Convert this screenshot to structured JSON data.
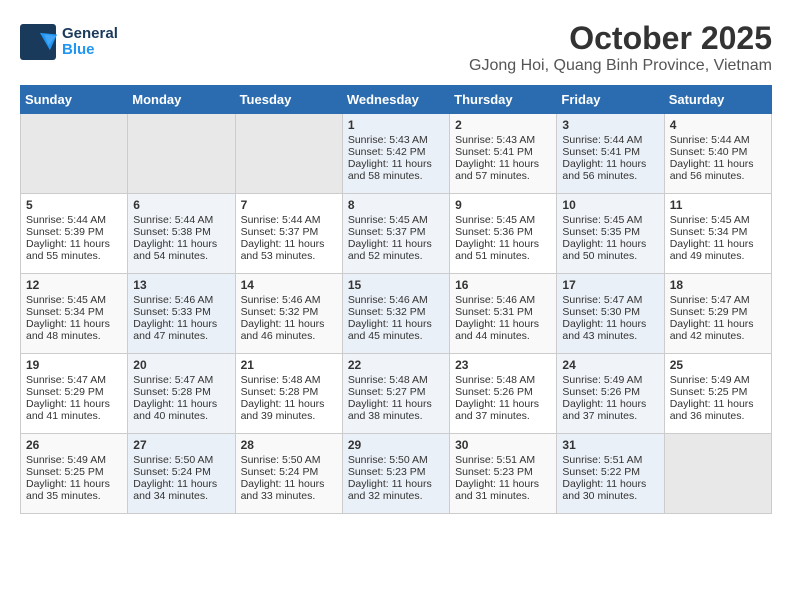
{
  "app": {
    "logo_general": "General",
    "logo_blue": "Blue",
    "title": "October 2025",
    "subtitle": "GJong Hoi, Quang Binh Province, Vietnam"
  },
  "calendar": {
    "days_of_week": [
      "Sunday",
      "Monday",
      "Tuesday",
      "Wednesday",
      "Thursday",
      "Friday",
      "Saturday"
    ],
    "weeks": [
      [
        {
          "day": "",
          "info": ""
        },
        {
          "day": "",
          "info": ""
        },
        {
          "day": "",
          "info": ""
        },
        {
          "day": "1",
          "info": "Sunrise: 5:43 AM\nSunset: 5:42 PM\nDaylight: 11 hours\nand 58 minutes."
        },
        {
          "day": "2",
          "info": "Sunrise: 5:43 AM\nSunset: 5:41 PM\nDaylight: 11 hours\nand 57 minutes."
        },
        {
          "day": "3",
          "info": "Sunrise: 5:44 AM\nSunset: 5:41 PM\nDaylight: 11 hours\nand 56 minutes."
        },
        {
          "day": "4",
          "info": "Sunrise: 5:44 AM\nSunset: 5:40 PM\nDaylight: 11 hours\nand 56 minutes."
        }
      ],
      [
        {
          "day": "5",
          "info": "Sunrise: 5:44 AM\nSunset: 5:39 PM\nDaylight: 11 hours\nand 55 minutes."
        },
        {
          "day": "6",
          "info": "Sunrise: 5:44 AM\nSunset: 5:38 PM\nDaylight: 11 hours\nand 54 minutes."
        },
        {
          "day": "7",
          "info": "Sunrise: 5:44 AM\nSunset: 5:37 PM\nDaylight: 11 hours\nand 53 minutes."
        },
        {
          "day": "8",
          "info": "Sunrise: 5:45 AM\nSunset: 5:37 PM\nDaylight: 11 hours\nand 52 minutes."
        },
        {
          "day": "9",
          "info": "Sunrise: 5:45 AM\nSunset: 5:36 PM\nDaylight: 11 hours\nand 51 minutes."
        },
        {
          "day": "10",
          "info": "Sunrise: 5:45 AM\nSunset: 5:35 PM\nDaylight: 11 hours\nand 50 minutes."
        },
        {
          "day": "11",
          "info": "Sunrise: 5:45 AM\nSunset: 5:34 PM\nDaylight: 11 hours\nand 49 minutes."
        }
      ],
      [
        {
          "day": "12",
          "info": "Sunrise: 5:45 AM\nSunset: 5:34 PM\nDaylight: 11 hours\nand 48 minutes."
        },
        {
          "day": "13",
          "info": "Sunrise: 5:46 AM\nSunset: 5:33 PM\nDaylight: 11 hours\nand 47 minutes."
        },
        {
          "day": "14",
          "info": "Sunrise: 5:46 AM\nSunset: 5:32 PM\nDaylight: 11 hours\nand 46 minutes."
        },
        {
          "day": "15",
          "info": "Sunrise: 5:46 AM\nSunset: 5:32 PM\nDaylight: 11 hours\nand 45 minutes."
        },
        {
          "day": "16",
          "info": "Sunrise: 5:46 AM\nSunset: 5:31 PM\nDaylight: 11 hours\nand 44 minutes."
        },
        {
          "day": "17",
          "info": "Sunrise: 5:47 AM\nSunset: 5:30 PM\nDaylight: 11 hours\nand 43 minutes."
        },
        {
          "day": "18",
          "info": "Sunrise: 5:47 AM\nSunset: 5:29 PM\nDaylight: 11 hours\nand 42 minutes."
        }
      ],
      [
        {
          "day": "19",
          "info": "Sunrise: 5:47 AM\nSunset: 5:29 PM\nDaylight: 11 hours\nand 41 minutes."
        },
        {
          "day": "20",
          "info": "Sunrise: 5:47 AM\nSunset: 5:28 PM\nDaylight: 11 hours\nand 40 minutes."
        },
        {
          "day": "21",
          "info": "Sunrise: 5:48 AM\nSunset: 5:28 PM\nDaylight: 11 hours\nand 39 minutes."
        },
        {
          "day": "22",
          "info": "Sunrise: 5:48 AM\nSunset: 5:27 PM\nDaylight: 11 hours\nand 38 minutes."
        },
        {
          "day": "23",
          "info": "Sunrise: 5:48 AM\nSunset: 5:26 PM\nDaylight: 11 hours\nand 37 minutes."
        },
        {
          "day": "24",
          "info": "Sunrise: 5:49 AM\nSunset: 5:26 PM\nDaylight: 11 hours\nand 37 minutes."
        },
        {
          "day": "25",
          "info": "Sunrise: 5:49 AM\nSunset: 5:25 PM\nDaylight: 11 hours\nand 36 minutes."
        }
      ],
      [
        {
          "day": "26",
          "info": "Sunrise: 5:49 AM\nSunset: 5:25 PM\nDaylight: 11 hours\nand 35 minutes."
        },
        {
          "day": "27",
          "info": "Sunrise: 5:50 AM\nSunset: 5:24 PM\nDaylight: 11 hours\nand 34 minutes."
        },
        {
          "day": "28",
          "info": "Sunrise: 5:50 AM\nSunset: 5:24 PM\nDaylight: 11 hours\nand 33 minutes."
        },
        {
          "day": "29",
          "info": "Sunrise: 5:50 AM\nSunset: 5:23 PM\nDaylight: 11 hours\nand 32 minutes."
        },
        {
          "day": "30",
          "info": "Sunrise: 5:51 AM\nSunset: 5:23 PM\nDaylight: 11 hours\nand 31 minutes."
        },
        {
          "day": "31",
          "info": "Sunrise: 5:51 AM\nSunset: 5:22 PM\nDaylight: 11 hours\nand 30 minutes."
        },
        {
          "day": "",
          "info": ""
        }
      ]
    ]
  }
}
